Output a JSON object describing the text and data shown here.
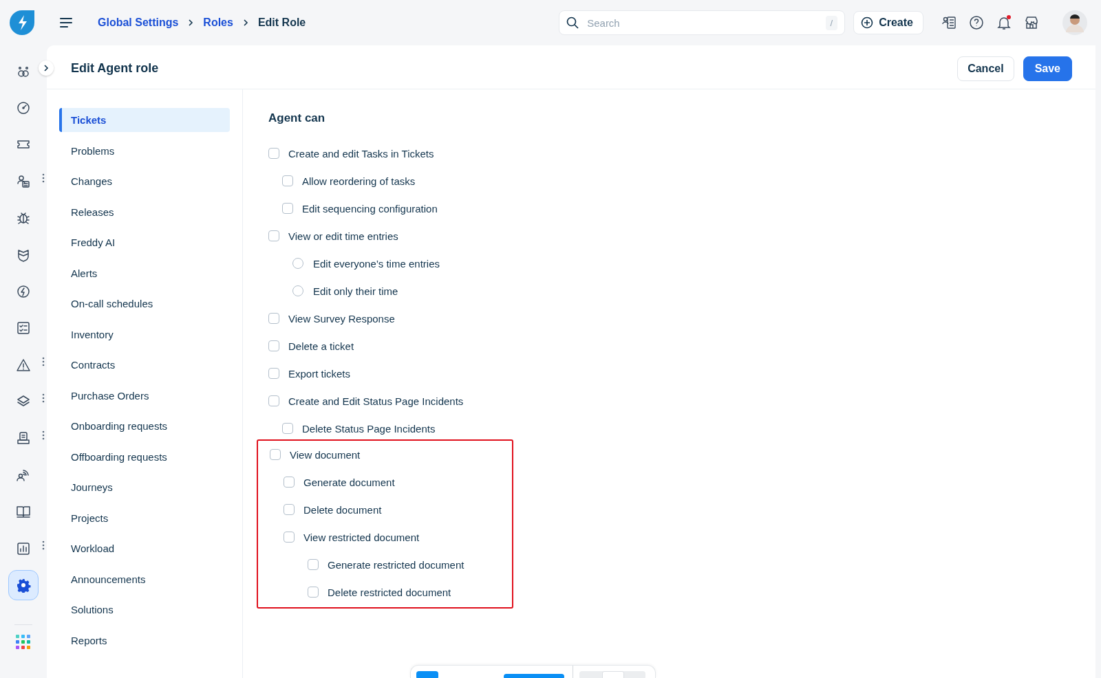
{
  "breadcrumb": [
    {
      "label": "Global Settings",
      "link": true
    },
    {
      "label": "Roles",
      "link": true
    },
    {
      "label": "Edit Role",
      "link": false
    }
  ],
  "search": {
    "placeholder": "Search",
    "shortcut": "/"
  },
  "create_button": "Create",
  "notifications": {
    "unread": true
  },
  "page_title": "Edit Agent role",
  "actions": {
    "cancel": "Cancel",
    "save": "Save"
  },
  "rail": [
    {
      "more": false,
      "selected": false
    },
    {
      "more": false,
      "selected": false
    },
    {
      "more": false,
      "selected": false
    },
    {
      "more": true,
      "selected": false
    },
    {
      "more": false,
      "selected": false
    },
    {
      "more": false,
      "selected": false
    },
    {
      "more": false,
      "selected": false
    },
    {
      "more": false,
      "selected": false
    },
    {
      "more": true,
      "selected": false
    },
    {
      "more": true,
      "selected": false
    },
    {
      "more": true,
      "selected": false
    },
    {
      "more": false,
      "selected": false
    },
    {
      "more": false,
      "selected": false
    },
    {
      "more": true,
      "selected": false
    },
    {
      "more": false,
      "selected": true
    }
  ],
  "nav": [
    {
      "label": "Tickets",
      "selected": true
    },
    {
      "label": "Problems",
      "selected": false
    },
    {
      "label": "Changes",
      "selected": false
    },
    {
      "label": "Releases",
      "selected": false
    },
    {
      "label": "Freddy AI",
      "selected": false
    },
    {
      "label": "Alerts",
      "selected": false
    },
    {
      "label": "On-call schedules",
      "selected": false
    },
    {
      "label": "Inventory",
      "selected": false
    },
    {
      "label": "Contracts",
      "selected": false
    },
    {
      "label": "Purchase Orders",
      "selected": false
    },
    {
      "label": "Onboarding requests",
      "selected": false
    },
    {
      "label": "Offboarding requests",
      "selected": false
    },
    {
      "label": "Journeys",
      "selected": false
    },
    {
      "label": "Projects",
      "selected": false
    },
    {
      "label": "Workload",
      "selected": false
    },
    {
      "label": "Announcements",
      "selected": false
    },
    {
      "label": "Solutions",
      "selected": false
    },
    {
      "label": "Reports",
      "selected": false
    }
  ],
  "section_title": "Agent can",
  "groups": [
    {
      "highlighted": false,
      "items": [
        {
          "kind": "checkbox",
          "label": "Create and edit Tasks in Tickets",
          "checked": false,
          "children": [
            {
              "kind": "checkbox",
              "label": "Allow reordering of tasks",
              "checked": false
            },
            {
              "kind": "checkbox",
              "label": "Edit sequencing configuration",
              "checked": false
            }
          ]
        },
        {
          "kind": "checkbox",
          "label": "View or edit time entries",
          "checked": false,
          "children": [
            {
              "kind": "radio",
              "label": "Edit everyone’s time entries",
              "checked": false
            },
            {
              "kind": "radio",
              "label": "Edit only their time",
              "checked": false
            }
          ]
        },
        {
          "kind": "checkbox",
          "label": "View Survey Response",
          "checked": false
        },
        {
          "kind": "checkbox",
          "label": "Delete a ticket",
          "checked": false
        },
        {
          "kind": "checkbox",
          "label": "Export tickets",
          "checked": false
        },
        {
          "kind": "checkbox",
          "label": "Create and Edit Status Page Incidents",
          "checked": false,
          "children": [
            {
              "kind": "checkbox",
              "label": "Delete Status Page Incidents",
              "checked": false
            }
          ]
        }
      ]
    },
    {
      "highlighted": true,
      "items": [
        {
          "kind": "checkbox",
          "label": "View document",
          "checked": false,
          "children": [
            {
              "kind": "checkbox",
              "label": "Generate document",
              "checked": false
            },
            {
              "kind": "checkbox",
              "label": "Delete document",
              "checked": false
            },
            {
              "kind": "checkbox",
              "label": "View restricted document",
              "checked": false,
              "children": [
                {
                  "kind": "checkbox",
                  "label": "Generate restricted document",
                  "checked": false
                },
                {
                  "kind": "checkbox",
                  "label": "Delete restricted document",
                  "checked": false
                }
              ]
            }
          ]
        }
      ]
    }
  ]
}
